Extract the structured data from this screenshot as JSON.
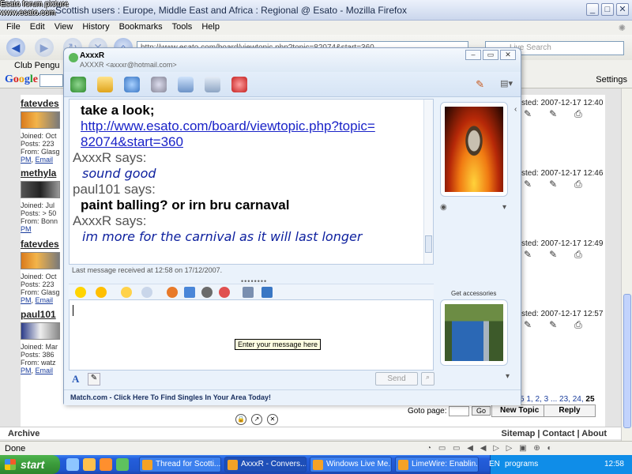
{
  "browser": {
    "watermark_line1": "Esato forum picture",
    "watermark_line2": "www.esato.com",
    "title": "Scottish users : Europe, Middle East and Africa : Regional @ Esato - Mozilla Firefox",
    "window_buttons": [
      "_",
      "□",
      "✕"
    ],
    "menu": [
      "File",
      "Edit",
      "View",
      "History",
      "Bookmarks",
      "Tools",
      "Help"
    ],
    "url": "http://www.esato.com/board/viewtopic.php?topic=82074&start=360",
    "search_placeholder": "Live Search",
    "bookmark": "Club Pengu",
    "google_toolbar_settings": "Settings",
    "status": "Done"
  },
  "forum": {
    "posts": [
      {
        "name": "fatevdes",
        "joined": "Joined: Oct",
        "posts": "Posts: 223",
        "from": "From: Glasg",
        "pm": "PM",
        "email": "Email",
        "posted": "sted: 2007-12-17 12:40"
      },
      {
        "name": "methyla",
        "joined": "Joined: Jul",
        "posts": "Posts: > 50",
        "from": "From: Bonn",
        "pm": "PM",
        "email": "",
        "posted": "sted: 2007-12-17 12:46"
      },
      {
        "name": "fatevdes",
        "joined": "Joined: Oct",
        "posts": "Posts: 223",
        "from": "From: Glasg",
        "pm": "PM",
        "email": "Email",
        "posted": "sted: 2007-12-17 12:49"
      },
      {
        "name": "paul101",
        "joined": "Joined: Mar",
        "posts": "Posts: 386",
        "from": "From: watz",
        "pm": "PM",
        "email": "Email",
        "posted": "sted: 2007-12-17 12:57"
      }
    ],
    "pager": "5  1, 2, 3 ... 23, 24,",
    "pager_current": "25",
    "goto_label": "Goto page:",
    "go_button": "Go",
    "new_topic": "New Topic",
    "reply": "Reply",
    "archive": "Archive",
    "footer_links": "Sitemap  |  Contact  |  About"
  },
  "messenger": {
    "contact_name": "AxxxR",
    "contact_email": "AXXXR <axxxr@hotmail.com>",
    "conversation": [
      {
        "type": "msg",
        "text": "take a look;"
      },
      {
        "type": "link",
        "text": "http://www.esato.com/board/viewtopic.php?topic="
      },
      {
        "type": "link",
        "text": "82074&start=360"
      },
      {
        "type": "says",
        "text": "AxxxR says:"
      },
      {
        "type": "ital",
        "text": "sound good"
      },
      {
        "type": "says",
        "text": "paul101 says:"
      },
      {
        "type": "msg",
        "text": "paint balling? or irn bru carnaval"
      },
      {
        "type": "says",
        "text": "AxxxR says:"
      },
      {
        "type": "ital",
        "text": "im more for the carnival as it will last longer"
      }
    ],
    "last_message": "Last message received at 12:58 on 17/12/2007.",
    "input_tooltip": "Enter your message here",
    "send_button": "Send",
    "get_accessories": "Get accessories",
    "ad_text": "Match.com - Click Here To Find Singles In Your Area Today!"
  },
  "taskbar": {
    "start": "start",
    "tasks": [
      "Thread for Scotti...",
      "AxxxR - Convers...",
      "Windows Live Me...",
      "LimeWire: Enablin..."
    ],
    "language": "EN",
    "programs": "programs",
    "clock": "12:58"
  }
}
